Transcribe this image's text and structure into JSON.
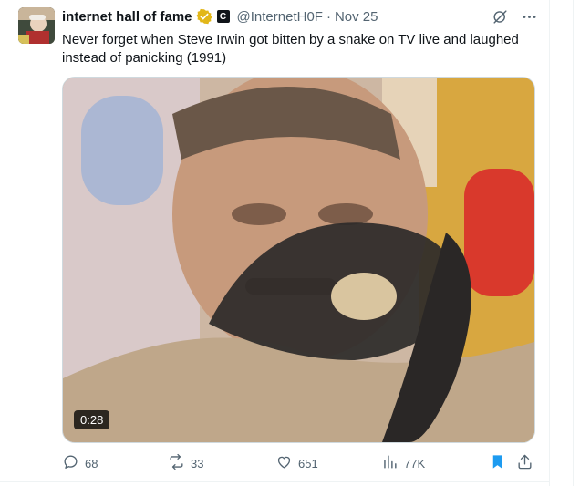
{
  "tweet": {
    "author_name": "internet hall of fame",
    "affiliate_badge": "C",
    "handle": "@InternetH0F",
    "separator": "·",
    "time": "Nov 25",
    "text": "Never forget when Steve Irwin got bitten by a snake on TV live and laughed instead of panicking (1991)",
    "media": {
      "duration": "0:28"
    },
    "stats": {
      "replies": "68",
      "reposts": "33",
      "likes": "651",
      "views": "77K"
    }
  },
  "colors": {
    "text": "#0f1419",
    "secondary": "#536471",
    "accent": "#1d9bf0",
    "verified_gold": "#e2b719"
  },
  "icons": [
    "verified-icon",
    "affiliate-icon",
    "grok-icon",
    "more-icon",
    "reply-icon",
    "repost-icon",
    "like-icon",
    "views-icon",
    "bookmark-icon",
    "share-icon"
  ]
}
